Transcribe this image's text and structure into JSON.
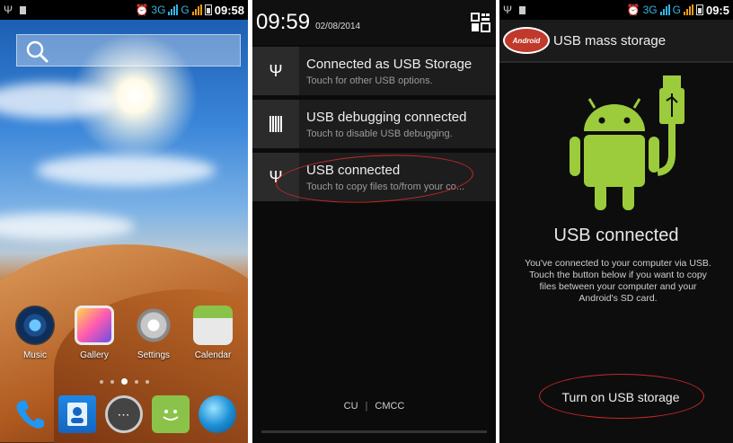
{
  "home_screen": {
    "status_bar": {
      "network": "3G",
      "time": "09:58"
    },
    "apps": [
      {
        "label": "Music",
        "icon": "music-icon"
      },
      {
        "label": "Gallery",
        "icon": "gallery-icon"
      },
      {
        "label": "Settings",
        "icon": "settings-icon"
      },
      {
        "label": "Calendar",
        "icon": "calendar-icon"
      }
    ],
    "dock": [
      "phone-icon",
      "contacts-icon",
      "app-drawer-icon",
      "messaging-icon",
      "browser-icon"
    ]
  },
  "notification_shade": {
    "time": "09:59",
    "date": "02/08/2014",
    "notifications": [
      {
        "title": "Connected as USB Storage",
        "subtitle": "Touch for other USB options.",
        "icon": "usb-icon"
      },
      {
        "title": "USB debugging connected",
        "subtitle": "Touch to disable USB debugging.",
        "icon": "debug-icon"
      },
      {
        "title": "USB connected",
        "subtitle": "Touch to copy files to/from your co...",
        "icon": "usb-icon"
      }
    ],
    "carriers": [
      "CU",
      "CMCC"
    ]
  },
  "usb_storage_screen": {
    "status_bar": {
      "network": "3G",
      "time": "09:5"
    },
    "logo_text": "Android",
    "title": "USB mass storage",
    "heading": "USB connected",
    "body_lines": [
      "You've connected to your computer via USB.",
      "Touch the button below if you want to copy",
      "files between your computer and your",
      "Android's SD card."
    ],
    "button_label": "Turn on USB storage"
  },
  "colors": {
    "accent_blue": "#33b5e5",
    "android_green": "#9ccc3c",
    "highlight_red": "#c62828"
  }
}
